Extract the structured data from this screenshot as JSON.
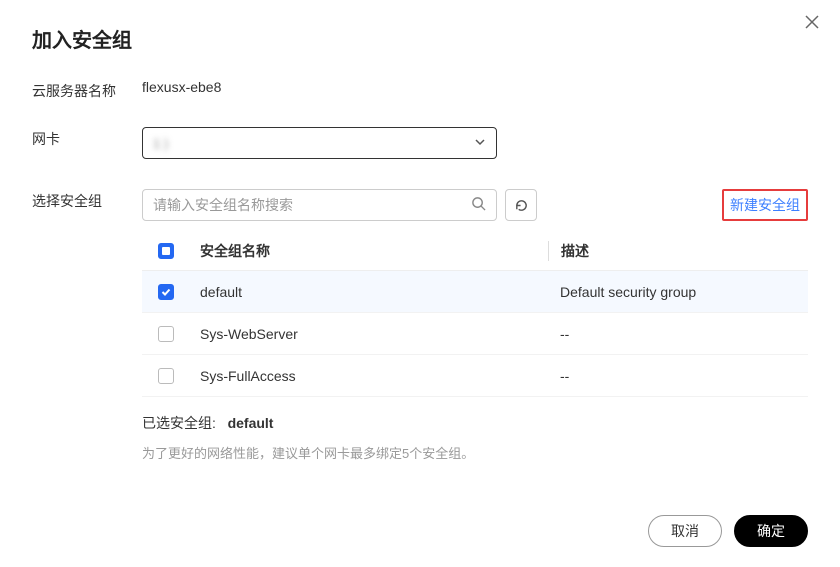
{
  "title": "加入安全组",
  "labels": {
    "server_name": "云服务器名称",
    "nic": "网卡",
    "select_sg": "选择安全组"
  },
  "server_name": "flexusx-ebe8",
  "nic_value": "1                       )",
  "search": {
    "placeholder": "请输入安全组名称搜索"
  },
  "new_sg_link": "新建安全组",
  "table": {
    "headers": {
      "name": "安全组名称",
      "desc": "描述"
    },
    "rows": [
      {
        "name": "default",
        "desc": "Default security group",
        "checked": true
      },
      {
        "name": "Sys-WebServer",
        "desc": "--",
        "checked": false
      },
      {
        "name": "Sys-FullAccess",
        "desc": "--",
        "checked": false
      }
    ]
  },
  "selected": {
    "label": "已选安全组:",
    "value": "default"
  },
  "tip": "为了更好的网络性能，建议单个网卡最多绑定5个安全组。",
  "buttons": {
    "cancel": "取消",
    "ok": "确定"
  }
}
